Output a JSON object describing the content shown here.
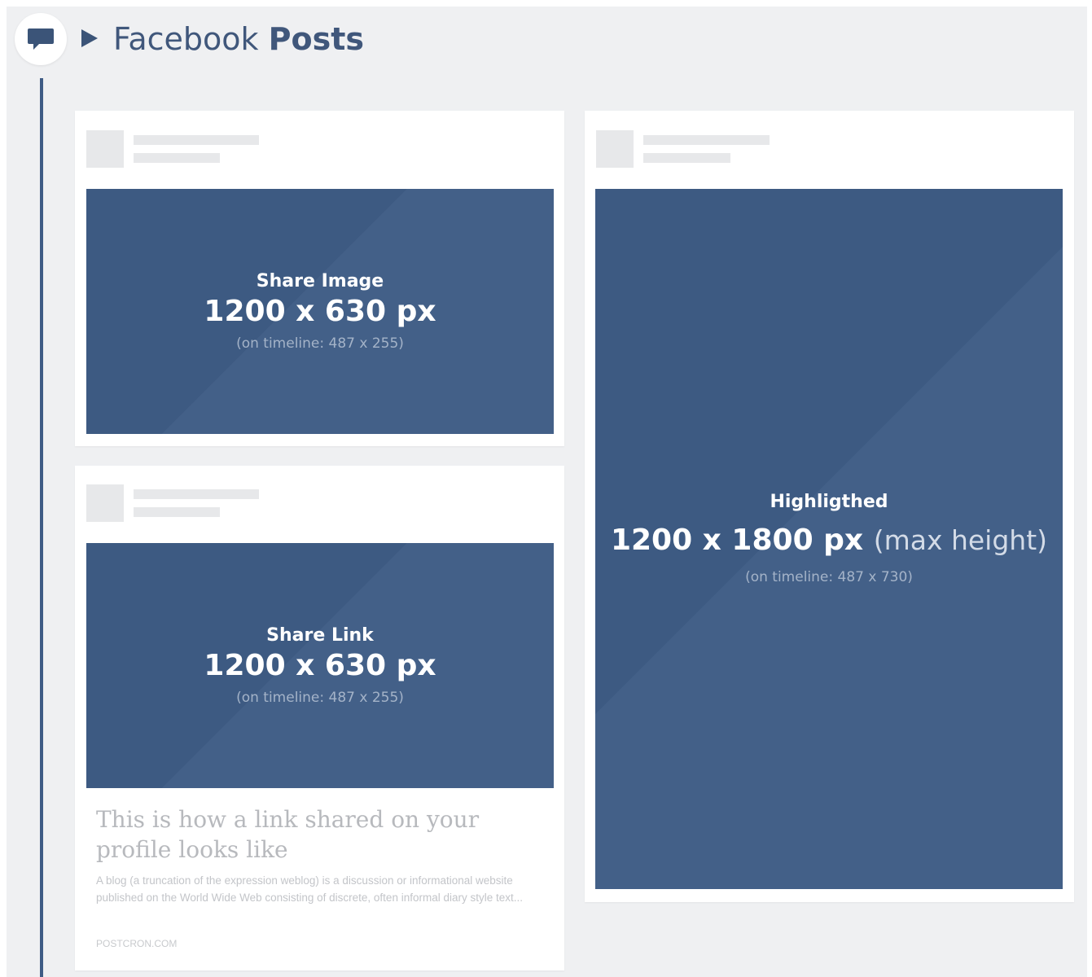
{
  "header": {
    "icon": "speech-bubble-icon",
    "arrow_icon": "triangle-right-icon",
    "title_regular": "Facebook",
    "title_bold": "Posts"
  },
  "cards": {
    "share_image": {
      "label": "Share Image",
      "dimensions": "1200 x 630 px",
      "timeline": "(on timeline: 487 x 255)"
    },
    "share_link": {
      "label": "Share Link",
      "dimensions": "1200 x 630 px",
      "timeline": "(on timeline: 487 x 255)",
      "link_title": "This is how a link shared on your profile looks like",
      "link_description": "A blog (a truncation of the expression weblog) is a discussion or informational website published on the World Wide Web consisting of discrete, often informal diary style text...",
      "link_domain": "POSTCRON.COM"
    },
    "highlighted": {
      "label": "Highligthed",
      "dimensions": "1200 x 1800 px",
      "dimensions_note": "(max height)",
      "timeline": "(on timeline: 487 x 730)"
    }
  },
  "colors": {
    "accent_blue": "#3d5a82",
    "timeline_line": "#3f5c85",
    "background": "#eff0f2",
    "placeholder": "#e7e8ea"
  }
}
